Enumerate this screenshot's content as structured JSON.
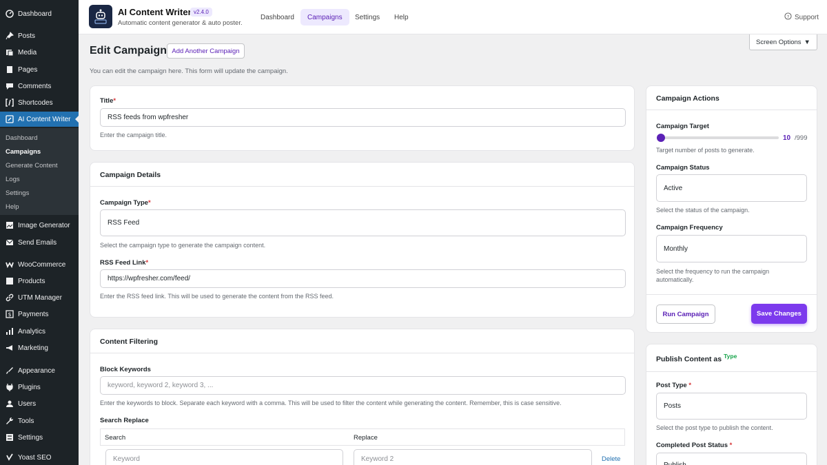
{
  "sidebar": {
    "items": [
      {
        "label": "Dashboard",
        "icon": "dashboard-icon"
      },
      {
        "label": "Posts",
        "icon": "pin-icon"
      },
      {
        "label": "Media",
        "icon": "media-icon"
      },
      {
        "label": "Pages",
        "icon": "pages-icon"
      },
      {
        "label": "Comments",
        "icon": "comment-icon"
      },
      {
        "label": "Shortcodes",
        "icon": "shortcode-icon"
      },
      {
        "label": "AI Content Writer",
        "icon": "pen-icon"
      },
      {
        "label": "Image Generator",
        "icon": "image-icon"
      },
      {
        "label": "Send Emails",
        "icon": "email-icon"
      },
      {
        "label": "WooCommerce",
        "icon": "woo-icon"
      },
      {
        "label": "Products",
        "icon": "box-icon"
      },
      {
        "label": "UTM Manager",
        "icon": "link-icon"
      },
      {
        "label": "Payments",
        "icon": "dollar-icon"
      },
      {
        "label": "Analytics",
        "icon": "chart-icon"
      },
      {
        "label": "Marketing",
        "icon": "megaphone-icon"
      },
      {
        "label": "Appearance",
        "icon": "brush-icon"
      },
      {
        "label": "Plugins",
        "icon": "plug-icon"
      },
      {
        "label": "Users",
        "icon": "user-icon"
      },
      {
        "label": "Tools",
        "icon": "wrench-icon"
      },
      {
        "label": "Settings",
        "icon": "settings-icon"
      },
      {
        "label": "Yoast SEO",
        "icon": "yoast-icon"
      }
    ],
    "submenu": [
      "Dashboard",
      "Campaigns",
      "Generate Content",
      "Logs",
      "Settings",
      "Help"
    ]
  },
  "topbar": {
    "title": "AI Content Writer",
    "version": "v2.4.0",
    "subtitle": "Automatic content generator & auto poster.",
    "tabs": [
      "Dashboard",
      "Campaigns",
      "Settings",
      "Help"
    ],
    "support": "Support"
  },
  "screen_options": "Screen Options",
  "page": {
    "title": "Edit Campaign",
    "add_button": "Add Another Campaign",
    "description": "You can edit the campaign here. This form will update the campaign."
  },
  "title_card": {
    "label": "Title",
    "required": "*",
    "value": "RSS feeds from wpfresher",
    "help": "Enter the campaign title."
  },
  "details_card": {
    "heading": "Campaign Details",
    "type_label": "Campaign Type",
    "type_value": "RSS Feed",
    "type_help": "Select the campaign type to generate the campaign content.",
    "feed_label": "RSS Feed Link",
    "feed_value": "https://wpfresher.com/feed/",
    "feed_help": "Enter the RSS feed link. This will be used to generate the content from the RSS feed."
  },
  "filtering_card": {
    "heading": "Content Filtering",
    "block_label": "Block Keywords",
    "block_placeholder": "keyword, keyword 2, keyword 3, ...",
    "block_help": "Enter the keywords to block. Separate each keyword with a comma. This will be used to filter the content while generating the content. Remember, this is case sensitive.",
    "replace_label": "Search Replace",
    "col_search": "Search",
    "col_replace": "Replace",
    "search_placeholder": "Keyword",
    "replace_placeholder": "Keyword 2",
    "delete": "Delete"
  },
  "actions_card": {
    "heading": "Campaign Actions",
    "target_label": "Campaign Target",
    "target_value": "10",
    "target_max": "/999",
    "target_fraction": 0.01,
    "target_help": "Target number of posts to generate.",
    "status_label": "Campaign Status",
    "status_value": "Active",
    "status_help": "Select the status of the campaign.",
    "frequency_label": "Campaign Frequency",
    "frequency_value": "Monthly",
    "frequency_help": "Select the frequency to run the campaign automatically.",
    "run_button": "Run Campaign",
    "save_button": "Save Changes"
  },
  "publish_card": {
    "heading": "Publish Content as",
    "badge": "Type",
    "post_type_label": "Post Type",
    "post_type_value": "Posts",
    "post_type_help": "Select the post type to publish the content.",
    "completed_label": "Completed Post Status",
    "completed_value": "Publish"
  },
  "colors": {
    "accent": "#7c3aed",
    "accent_dark": "#5b21b6",
    "wp_sidebar": "#1d2327",
    "wp_active": "#2271b1"
  }
}
